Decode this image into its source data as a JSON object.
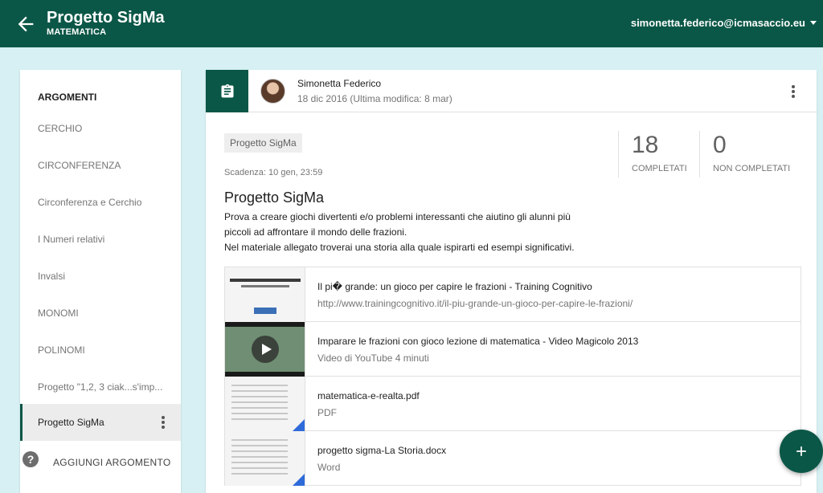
{
  "header": {
    "title": "Progetto SigMa",
    "subtitle": "MATEMATICA",
    "account": "simonetta.federico@icmasaccio.eu",
    "back_icon": "arrow-back-icon",
    "account_caret_icon": "caret-down-icon",
    "color": "#0b5747"
  },
  "sidebar": {
    "heading": "ARGOMENTI",
    "items": [
      {
        "label": "CERCHIO"
      },
      {
        "label": "CIRCONFERENZA"
      },
      {
        "label": "Circonferenza e Cerchio"
      },
      {
        "label": "I Numeri relativi"
      },
      {
        "label": "Invalsi"
      },
      {
        "label": "MONOMI"
      },
      {
        "label": "POLINOMI"
      },
      {
        "label": "Progetto \"1,2, 3 ciak...s'imp..."
      },
      {
        "label": "Progetto SigMa",
        "active": true
      }
    ],
    "add_label": "AGGIUNGI ARGOMENTO",
    "help_icon": "help-icon"
  },
  "post": {
    "author": "Simonetta Federico",
    "date": "18 dic 2016 (Ultima modifica: 8 mar)",
    "class_chip": "Progetto SigMa",
    "due": "Scadenza: 10 gen, 23:59",
    "completed_count": "18",
    "completed_label": "COMPLETATI",
    "not_completed_count": "0",
    "not_completed_label": "NON COMPLETATI",
    "title": "Progetto SigMa",
    "description_lines": [
      "Prova a creare giochi divertenti e/o problemi interessanti che aiutino gli alunni più",
      "piccoli ad affrontare il mondo delle frazioni.",
      "Nel materiale allegato troverai una storia alla quale ispirarti ed esempi significativi."
    ],
    "attachments": [
      {
        "title": "Il pi� grande: un gioco per capire le frazioni - Training Cognitivo",
        "meta": "http://www.trainingcognitivo.it/il-piu-grande-un-gioco-per-capire-le-frazioni/"
      },
      {
        "title": "Imparare le frazioni con gioco lezione di matematica - Video Magicolo 2013",
        "meta": "Video di YouTube   4 minuti"
      },
      {
        "title": "matematica-e-realta.pdf",
        "meta": "PDF"
      },
      {
        "title": "progetto sigma-La Storia.docx",
        "meta": "Word"
      }
    ]
  },
  "fab_icon": "plus-icon"
}
